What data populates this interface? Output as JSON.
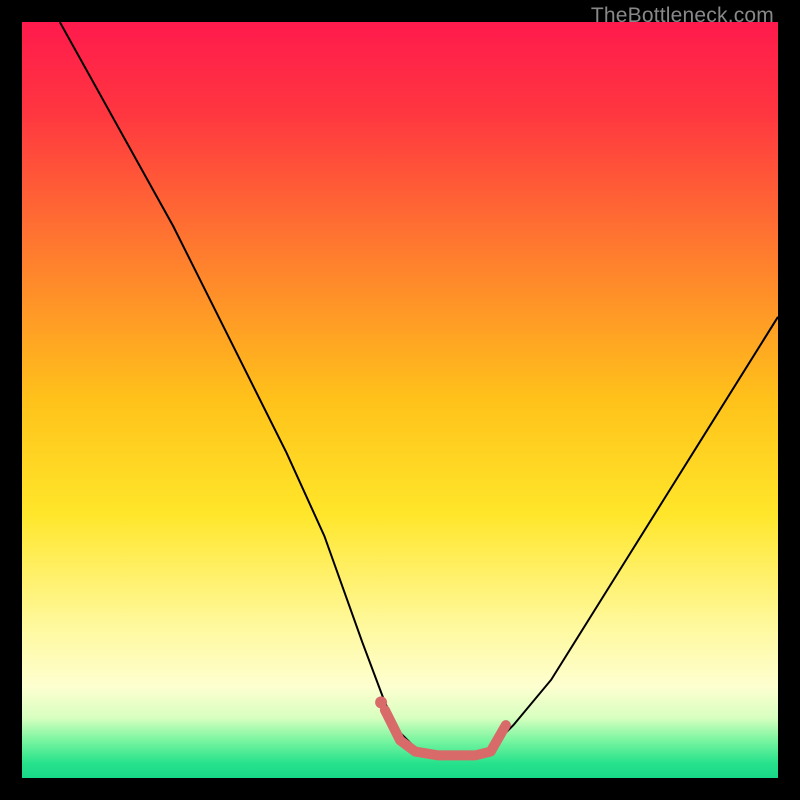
{
  "watermark": "TheBottleneck.com",
  "chart_data": {
    "type": "line",
    "title": "",
    "xlabel": "",
    "ylabel": "",
    "xlim": [
      0,
      100
    ],
    "ylim": [
      0,
      100
    ],
    "legend": false,
    "grid": false,
    "background_gradient": {
      "stops": [
        {
          "offset": 0.0,
          "color": "#ff1a4d"
        },
        {
          "offset": 0.12,
          "color": "#ff3640"
        },
        {
          "offset": 0.3,
          "color": "#ff7a2f"
        },
        {
          "offset": 0.5,
          "color": "#ffc21a"
        },
        {
          "offset": 0.65,
          "color": "#ffe62a"
        },
        {
          "offset": 0.8,
          "color": "#fff99e"
        },
        {
          "offset": 0.88,
          "color": "#fdffd0"
        },
        {
          "offset": 0.92,
          "color": "#d8ffc0"
        },
        {
          "offset": 0.95,
          "color": "#7af5a0"
        },
        {
          "offset": 0.98,
          "color": "#28e28c"
        },
        {
          "offset": 1.0,
          "color": "#17d888"
        }
      ]
    },
    "series": [
      {
        "name": "bottleneck_curve",
        "color": "#000000",
        "stroke_width": 2,
        "x": [
          5,
          10,
          15,
          20,
          25,
          30,
          35,
          40,
          45,
          48,
          50,
          52,
          55,
          58,
          60,
          62,
          65,
          70,
          75,
          80,
          85,
          90,
          95,
          100
        ],
        "y": [
          100,
          91,
          82,
          73,
          63,
          53,
          43,
          32,
          18,
          10,
          6,
          4,
          3,
          3,
          3,
          4,
          7,
          13,
          21,
          29,
          37,
          45,
          53,
          61
        ]
      },
      {
        "name": "sweet_spot_marker",
        "color": "#d86a6a",
        "stroke_width": 10,
        "linecap": "round",
        "x": [
          48,
          50,
          52,
          55,
          58,
          60,
          62,
          64
        ],
        "y": [
          9,
          5,
          3.5,
          3,
          3,
          3,
          3.5,
          7
        ]
      },
      {
        "name": "sweet_spot_dot",
        "type": "scatter",
        "color": "#d86a6a",
        "radius": 6,
        "x": [
          47.5
        ],
        "y": [
          10
        ]
      }
    ]
  }
}
